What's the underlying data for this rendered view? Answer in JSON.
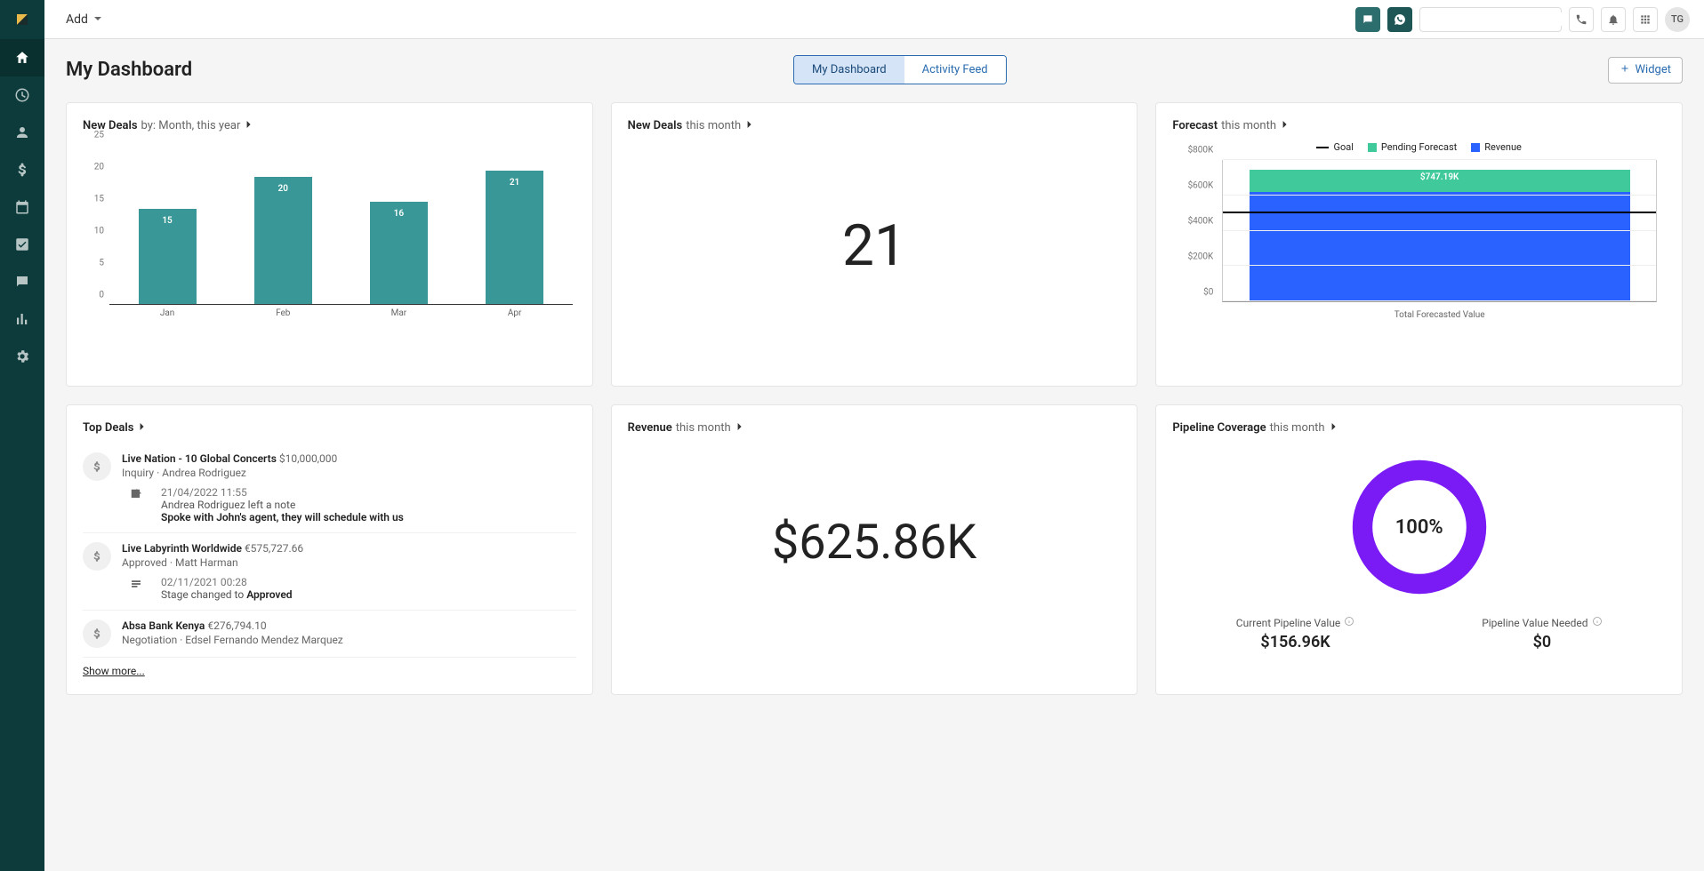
{
  "topbar": {
    "add_label": "Add",
    "search_placeholder": "",
    "avatar_initials": "TG"
  },
  "page": {
    "title": "My Dashboard",
    "tabs": {
      "dash": "My Dashboard",
      "feed": "Activity Feed"
    },
    "widget_btn": "Widget"
  },
  "cards": {
    "new_deals_chart": {
      "title_strong": "New Deals",
      "title_light": " by: Month, this year"
    },
    "new_deals_count": {
      "title_strong": "New Deals",
      "title_light": " this month",
      "value": "21"
    },
    "forecast": {
      "title_strong": "Forecast",
      "title_light": " this month",
      "legend": {
        "goal": "Goal",
        "pending": "Pending Forecast",
        "revenue": "Revenue"
      },
      "anno": "$747.19K",
      "xlabel": "Total Forecasted Value"
    },
    "top_deals": {
      "title_strong": "Top Deals",
      "items": [
        {
          "name": "Live Nation - 10 Global Concerts",
          "amount": "$10,000,000",
          "stage_owner": "Inquiry · Andrea Rodriguez",
          "sub_dt": "21/04/2022 11:55",
          "sub_l1": "Andrea Rodriguez left a note",
          "sub_l2": "Spoke with John's agent, they will schedule with us",
          "sub_icon": "note"
        },
        {
          "name": "Live Labyrinth Worldwide",
          "amount": "€575,727.66",
          "stage_owner": "Approved · Matt Harman",
          "sub_dt": "02/11/2021 00:28",
          "sub_l1_prefix": "Stage changed to ",
          "sub_l1_bold": "Approved",
          "sub_icon": "stage"
        },
        {
          "name": "Absa Bank Kenya",
          "amount": "€276,794.10",
          "stage_owner": "Negotiation · Edsel Fernando Mendez Marquez"
        }
      ],
      "show_more": "Show more..."
    },
    "revenue": {
      "title_strong": "Revenue",
      "title_light": " this month",
      "value": "$625.86K"
    },
    "pipeline": {
      "title_strong": "Pipeline Coverage",
      "title_light": " this month",
      "pct": "100%",
      "current_label": "Current Pipeline Value",
      "current_value": "$156.96K",
      "needed_label": "Pipeline Value Needed",
      "needed_value": "$0"
    }
  },
  "chart_data": [
    {
      "id": "new_deals_by_month",
      "type": "bar",
      "categories": [
        "Jan",
        "Feb",
        "Mar",
        "Apr"
      ],
      "values": [
        15,
        20,
        16,
        21
      ],
      "ylim": [
        0,
        25
      ],
      "yticks": [
        0,
        5,
        10,
        15,
        20,
        25
      ],
      "color": "#3a9797"
    },
    {
      "id": "forecast",
      "type": "bar",
      "categories": [
        "Total Forecasted Value"
      ],
      "series": [
        {
          "name": "Revenue",
          "values": [
            620
          ],
          "color": "#2962ff"
        },
        {
          "name": "Pending Forecast",
          "values": [
            127.19
          ],
          "color": "#40c99b"
        }
      ],
      "goal_line": 500,
      "total_label": "$747.19K",
      "ylim": [
        0,
        800
      ],
      "yticks": [
        "$0",
        "$200K",
        "$400K",
        "$600K",
        "$800K"
      ],
      "ylabel_unit": "K"
    },
    {
      "id": "pipeline_coverage_donut",
      "type": "pie",
      "value_pct": 100,
      "color": "#7a1af5"
    }
  ]
}
